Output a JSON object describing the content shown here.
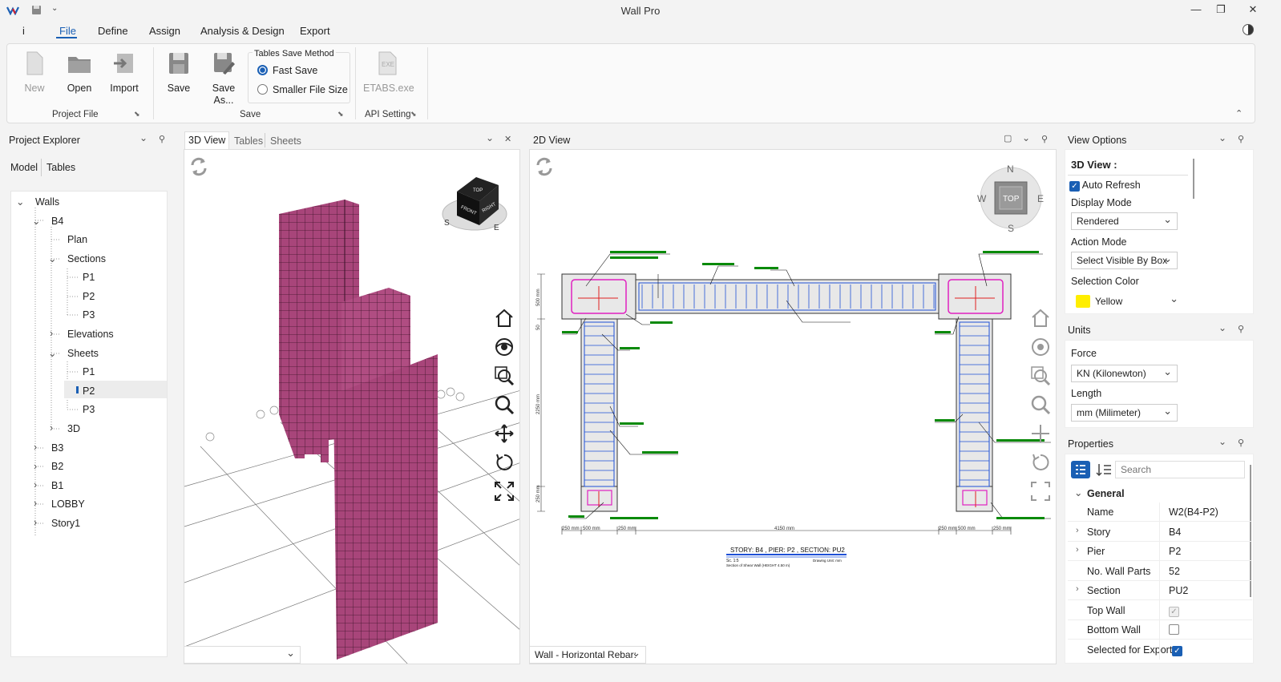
{
  "app": {
    "title": "Wall Pro"
  },
  "menu": {
    "info": "i",
    "items": [
      "File",
      "Define",
      "Assign",
      "Analysis & Design",
      "Export"
    ]
  },
  "ribbon": {
    "new": "New",
    "open": "Open",
    "import": "Import",
    "project_file": "Project File",
    "save": "Save",
    "save_as_1": "Save",
    "save_as_2": "As...",
    "tables_save_method": "Tables Save Method",
    "fast_save": "Fast Save",
    "smaller_file_size": "Smaller File Size",
    "save_group": "Save",
    "etabs": "ETABS.exe",
    "etabs_icon_text": "EXE",
    "api_setting": "API Setting"
  },
  "explorer": {
    "title": "Project Explorer",
    "tabs": [
      "Model",
      "Tables"
    ],
    "tree": {
      "walls": "Walls",
      "b4": "B4",
      "plan": "Plan",
      "sections": "Sections",
      "s_p1": "P1",
      "s_p2": "P2",
      "s_p3": "P3",
      "elevations": "Elevations",
      "sheets": "Sheets",
      "sh_p1": "P1",
      "sh_p2": "P2",
      "sh_p3": "P3",
      "threed": "3D",
      "b3": "B3",
      "b2": "B2",
      "b1": "B1",
      "lobby": "LOBBY",
      "story1": "Story1"
    }
  },
  "view3d": {
    "tabs": [
      "3D View",
      "Tables",
      "Sheets"
    ],
    "cube_top": "TOP",
    "cube_front": "FRONT",
    "cube_right": "RIGHT",
    "compass_s": "S",
    "compass_e": "E"
  },
  "view2d": {
    "title": "2D View",
    "compass": {
      "n": "N",
      "s": "S",
      "w": "W",
      "e": "E",
      "top": "TOP"
    },
    "drawing_title": "STORY: B4 , PIER: P2 , SECTION: PU2",
    "scale_note": "Sc. 1:5",
    "section_note": "Section of Shear Wall (HEIGHT 4.50 m)",
    "drawing_unit": "Drawing Unit: mm",
    "dims": [
      "250 mm",
      "500 mm",
      "250 mm",
      "4150 mm",
      "250 mm",
      "500 mm",
      "250 mm"
    ],
    "vdims": [
      "500 mm",
      "2250 mm",
      "250 mm",
      "50"
    ],
    "bottom_dropdown": "Wall - Horizontal Rebar:"
  },
  "view_options": {
    "title": "View Options",
    "section": "3D View :",
    "auto_refresh": "Auto Refresh",
    "display_mode_label": "Display Mode",
    "display_mode": "Rendered",
    "action_mode_label": "Action Mode",
    "action_mode": "Select Visible By Box",
    "selection_color_label": "Selection Color",
    "selection_color": "Yellow",
    "selection_swatch": "#ffee00"
  },
  "units": {
    "title": "Units",
    "force_label": "Force",
    "force": "KN (Kilonewton)",
    "length_label": "Length",
    "length": "mm (Milimeter)"
  },
  "properties": {
    "title": "Properties",
    "search_placeholder": "Search",
    "group": "General",
    "rows": [
      {
        "k": "Name",
        "v": "W2(B4-P2)"
      },
      {
        "k": "Story",
        "v": "B4"
      },
      {
        "k": "Pier",
        "v": "P2"
      },
      {
        "k": "No. Wall Parts",
        "v": "52"
      },
      {
        "k": "Section",
        "v": "PU2"
      },
      {
        "k": "Top Wall",
        "v": ""
      },
      {
        "k": "Bottom Wall",
        "v": ""
      },
      {
        "k": "Selected for Export",
        "v": ""
      }
    ]
  },
  "colors": {
    "accent": "#1a5fb4",
    "wall": "#a8457a",
    "rebar": "#1e50d6",
    "label": "#0a8a0a"
  }
}
